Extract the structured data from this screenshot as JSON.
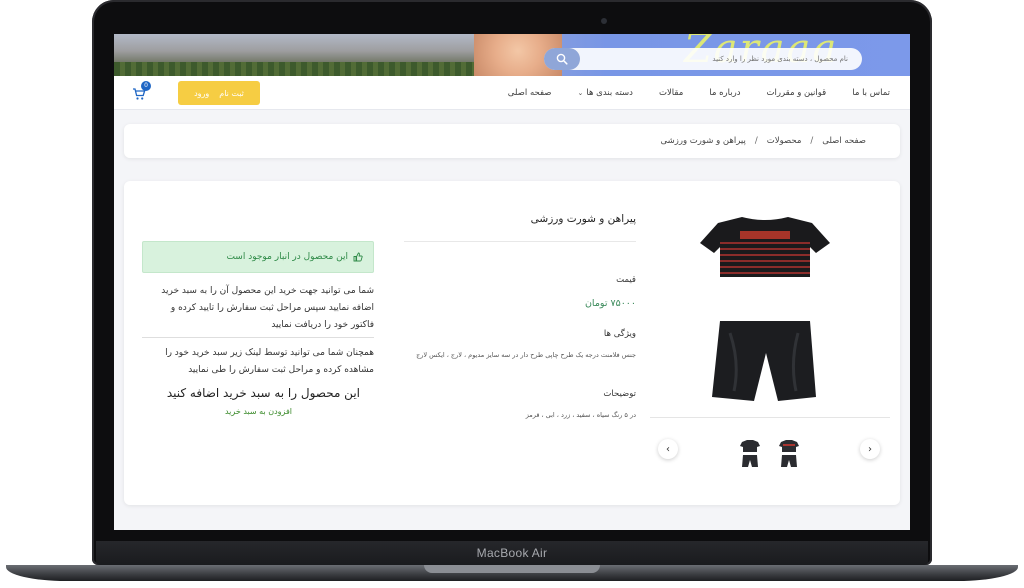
{
  "device": {
    "label": "MacBook Air"
  },
  "header": {
    "search": {
      "placeholder": "نام محصول ، دسته بندی مورد نظر را وارد کنید"
    },
    "nav": [
      "صفحه اصلی",
      "دسته بندی ها",
      "مقالات",
      "درباره ما",
      "قوانین و مقررات",
      "تماس با ما"
    ],
    "auth": {
      "login": "ورود",
      "register": "ثبت نام"
    },
    "cart": {
      "count": "0"
    }
  },
  "breadcrumb": [
    "صفحه اصلی",
    "محصولات",
    "پیراهن و شورت ورزشی"
  ],
  "product": {
    "title": "پیراهن و شورت ورزشی",
    "price_label": "قیمت",
    "price": "۷۵۰۰۰ تومان",
    "features_label": "ویژگی ها",
    "features": "جنس فلامنت درجه یک  طرح چاپی طرح دار در سه سایز مدیوم  ، لارج ، ایکس لارج",
    "description_label": "توضیحات",
    "description": "در ۵ رنگ سیاه ، سفید ، زرد ، ابی ، قرمز"
  },
  "purchase": {
    "stock_status": "این محصول در انبار موجود است",
    "instructions": "شما می توانید جهت خرید این محصول آن را به سبد خرید اضافه نمایید سپس مراحل ثبت سفارش را تایید کرده و فاکتور خود را دریافت نمایید",
    "cart_info": "همچنان شما می توانید توسط لینک زیر سبد خرید خود را مشاهده کرده و مراحل ثبت سفارش را طی نمایید",
    "cta_title": "این محصول را به سبد خرید اضافه کنید",
    "add_to_cart": "افزودن به سبد خرید"
  },
  "colors": {
    "accent_yellow": "#f6cd43",
    "stock_green": "#d8f2dd",
    "price_green": "#3a8a5a",
    "badge_blue": "#1f66c4"
  }
}
